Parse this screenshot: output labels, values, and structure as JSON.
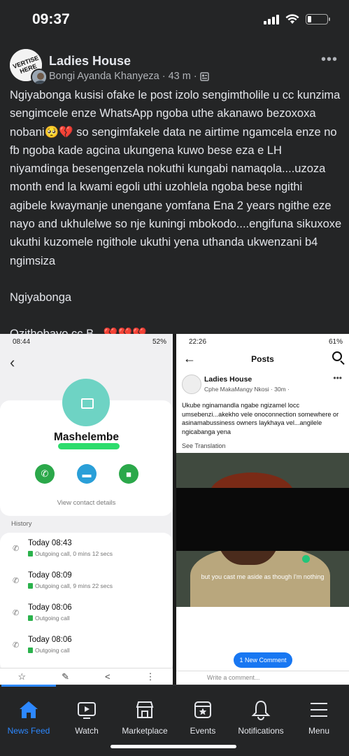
{
  "status_bar": {
    "time": "09:37",
    "battery_level": 0.2
  },
  "post": {
    "group_name": "Ladies House",
    "author": "Bongi Ayanda Khanyeza",
    "age": "43 m",
    "body": "Ngiyabonga kusisi ofake le post izolo sengimtholile u cc kunzima sengimcele enze WhatsApp ngoba uthe akanawo bezoxoxa nobani🥺💔 so sengimfakele data ne airtime ngamcela enze no fb ngoba kade agcina ukungena kuwo bese eza e LH niyamdinga besengenzela nokuthi kungabi namaqola....uzoza month end la kwami egoli uthi uzohlela ngoba bese ngithi agibele kwaymanje unengane yomfana Ena 2 years ngithe eze nayo and ukhulelwe so nje kuningi mbokodo....engifuna sikuxoxe ukuthi kuzomele ngithole ukuthi yena uthanda ukwenzani b4 ngimsiza",
    "para2": "Ngiyabonga",
    "para3": "Ozithobayo cc B...💔💔💔"
  },
  "left_screenshot": {
    "status_time": "08:44",
    "status_battery": "52%",
    "contact_name": "Mashelembe",
    "view_details": "View contact details",
    "history_label": "History",
    "history": [
      {
        "time": "Today 08:43",
        "detail": "Outgoing call, 0 mins 12 secs"
      },
      {
        "time": "Today 08:09",
        "detail": "Outgoing call, 9 mins 22 secs"
      },
      {
        "time": "Today 08:06",
        "detail": "Outgoing call"
      },
      {
        "time": "Today 08:06",
        "detail": "Outgoing call"
      }
    ]
  },
  "right_screenshot": {
    "status_time": "22:26",
    "status_battery": "61%",
    "title": "Posts",
    "group_name": "Ladies House",
    "author_meta": "Cphe MakaMangy Nkosi · 30m ·",
    "text": "Ukube nginamandla ngabe ngizamel locc umsebenzi...akekho vele onoconnection somewhere or asinamabussiness owners laykhaya vel...angilele ngicabanga yena",
    "see_translation": "See Translation",
    "subtitle": "but you cast me aside as though I'm nothing",
    "new_comment": "1 New Comment",
    "write_comment": "Write a comment..."
  },
  "bottom_nav": {
    "items": [
      {
        "label": "News Feed",
        "icon": "home-icon"
      },
      {
        "label": "Watch",
        "icon": "video-icon"
      },
      {
        "label": "Marketplace",
        "icon": "shop-icon"
      },
      {
        "label": "Events",
        "icon": "calendar-star-icon"
      },
      {
        "label": "Notifications",
        "icon": "bell-icon"
      },
      {
        "label": "Menu",
        "icon": "menu-icon"
      }
    ]
  },
  "colors": {
    "background": "#242526",
    "accent": "#2d88ff",
    "text": "#e4e6eb",
    "muted": "#b0b3b8"
  }
}
